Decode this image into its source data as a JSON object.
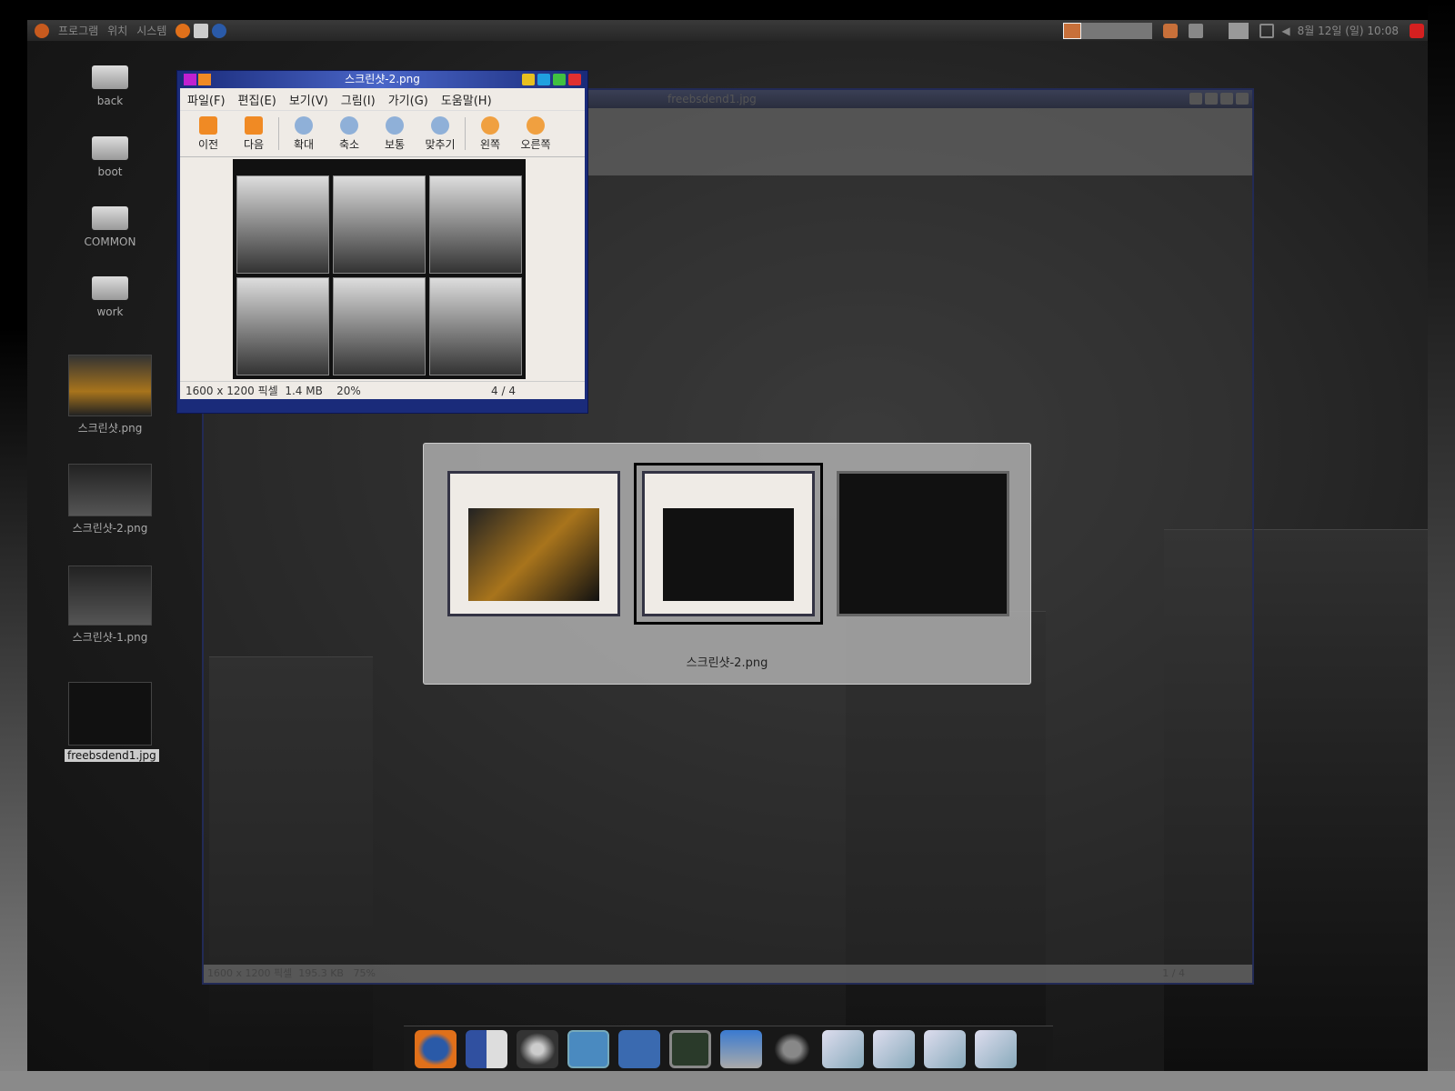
{
  "panel": {
    "menus": [
      "프로그램",
      "위치",
      "시스템"
    ],
    "launchers": [
      "firefox-icon",
      "mail-icon",
      "help-icon"
    ],
    "clock": "8월 12일 (일) 10:08"
  },
  "desktop_icons": [
    {
      "label": "back",
      "type": "drive"
    },
    {
      "label": "boot",
      "type": "drive"
    },
    {
      "label": "COMMON",
      "type": "drive"
    },
    {
      "label": "work",
      "type": "drive"
    },
    {
      "label": "스크린샷.png",
      "type": "image"
    },
    {
      "label": "스크린샷-2.png",
      "type": "image"
    },
    {
      "label": "스크린샷-1.png",
      "type": "image"
    },
    {
      "label": "freebsdend1.jpg",
      "type": "image"
    }
  ],
  "viewer": {
    "title": "스크린샷-2.png",
    "menu": [
      "파일(F)",
      "편집(E)",
      "보기(V)",
      "그림(I)",
      "가기(G)",
      "도움말(H)"
    ],
    "toolbar": [
      "이전",
      "다음",
      "확대",
      "축소",
      "보통",
      "맞추기",
      "왼쪽",
      "오른쪽"
    ],
    "status": {
      "dims": "1600 x 1200 픽셀",
      "size": "1.4 MB",
      "zoom": "20%",
      "index": "4 / 4"
    }
  },
  "bg_window": {
    "title": "freebsdend1.jpg",
    "status": {
      "dims": "1600 x 1200 픽셀",
      "size": "195.3 KB",
      "zoom": "75%",
      "index": "1 / 4"
    }
  },
  "switcher": {
    "selected_label": "스크린샷-2.png"
  },
  "dock": [
    "firefox",
    "file-manager",
    "media",
    "system-monitor",
    "help",
    "terminal",
    "screenshot",
    "gimp",
    "image-viewer",
    "image-viewer",
    "image-viewer",
    "image-viewer"
  ],
  "colors": {
    "titlebar": "#1a2b7a",
    "window_bg": "#efebe6",
    "accent": "#f08a24"
  }
}
